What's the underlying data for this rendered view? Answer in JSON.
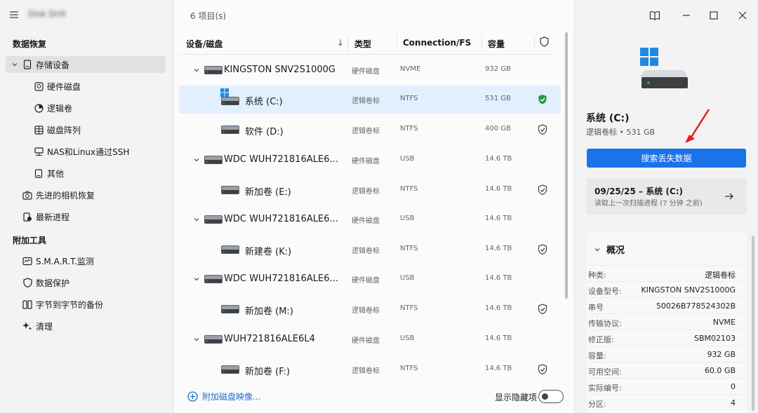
{
  "app": {
    "title": "Disk Drill"
  },
  "sidebar": {
    "section_recovery": "数据恢复",
    "storage": "存储设备",
    "items": [
      {
        "label": "硬件磁盘",
        "icon": "hard-disk-icon"
      },
      {
        "label": "逻辑卷",
        "icon": "pie-icon"
      },
      {
        "label": "磁盘阵列",
        "icon": "raid-icon"
      },
      {
        "label": "NAS和Linux通过SSH",
        "icon": "network-icon"
      },
      {
        "label": "其他",
        "icon": "device-icon"
      }
    ],
    "camera": "先进的相机恢复",
    "recent": "最新进程",
    "section_tools": "附加工具",
    "tools": [
      {
        "label": "S.M.A.R.T.监测",
        "icon": "smart-icon"
      },
      {
        "label": "数据保护",
        "icon": "shield-icon"
      },
      {
        "label": "字节到字节的备份",
        "icon": "backup-icon"
      },
      {
        "label": "清理",
        "icon": "sparkle-icon"
      }
    ]
  },
  "main": {
    "item_count": "6 项目(s)",
    "columns": {
      "device": "设备/磁盘",
      "sort": "↓",
      "type": "类型",
      "conn": "Connection/FS",
      "capacity": "容量"
    },
    "rows": [
      {
        "kind": "disk",
        "name": "KINGSTON SNV2S1000G",
        "type": "硬件磁盘",
        "conn": "NVME",
        "cap": "932 GB"
      },
      {
        "kind": "vol",
        "name": "系统 (C:)",
        "type": "逻辑卷标",
        "conn": "NTFS",
        "cap": "531 GB",
        "protected": true,
        "selected": true,
        "system": true
      },
      {
        "kind": "vol",
        "name": "软件 (D:)",
        "type": "逻辑卷标",
        "conn": "NTFS",
        "cap": "400 GB",
        "protected": false
      },
      {
        "kind": "disk",
        "name": "WDC  WUH721816ALE6...",
        "type": "硬件磁盘",
        "conn": "USB",
        "cap": "14.6 TB"
      },
      {
        "kind": "vol",
        "name": "新加卷 (E:)",
        "type": "逻辑卷标",
        "conn": "NTFS",
        "cap": "14.6 TB",
        "protected": false
      },
      {
        "kind": "disk",
        "name": "WDC  WUH721816ALE6...",
        "type": "硬件磁盘",
        "conn": "USB",
        "cap": "14.6 TB"
      },
      {
        "kind": "vol",
        "name": "新建卷 (K:)",
        "type": "逻辑卷标",
        "conn": "NTFS",
        "cap": "14.6 TB",
        "protected": false
      },
      {
        "kind": "disk",
        "name": "WDC  WUH721816ALE6...",
        "type": "硬件磁盘",
        "conn": "USB",
        "cap": "14.6 TB"
      },
      {
        "kind": "vol",
        "name": "新加卷 (M:)",
        "type": "逻辑卷标",
        "conn": "NTFS",
        "cap": "14.6 TB",
        "protected": false
      },
      {
        "kind": "disk",
        "name": "WUH721816ALE6L4",
        "type": "硬件磁盘",
        "conn": "USB",
        "cap": "14.6 TB"
      },
      {
        "kind": "vol",
        "name": "新加卷 (F:)",
        "type": "逻辑卷标",
        "conn": "NTFS",
        "cap": "14.6 TB",
        "protected": false
      }
    ],
    "add_image": "附加磁盘映像...",
    "show_hidden": "显示隐藏项"
  },
  "details": {
    "title": "系统 (C:)",
    "subtitle": "逻辑卷标 • 531 GB",
    "search_button": "搜索丢失数据",
    "last_scan_title": "09/25/25 – 系统 (C:)",
    "last_scan_sub": "读取上一次扫描进程 (7 分钟 之前)",
    "overview_title": "概况",
    "overview": [
      {
        "k": "种类:",
        "v": "逻辑卷标"
      },
      {
        "k": "设备型号:",
        "v": "KINGSTON SNV2S1000G"
      },
      {
        "k": "串号",
        "v": "50026B778524302B"
      },
      {
        "k": "传输协议:",
        "v": "NVME"
      },
      {
        "k": "修正版:",
        "v": "SBM02103"
      },
      {
        "k": "容量:",
        "v": "932 GB"
      },
      {
        "k": "可用空间:",
        "v": "60.0 GB"
      },
      {
        "k": "实际编号:",
        "v": "0"
      },
      {
        "k": "分区:",
        "v": "4"
      }
    ]
  },
  "colors": {
    "accent": "#1a73e8",
    "protected": "#1e9e4a",
    "annotation_arrow": "#e02020"
  }
}
